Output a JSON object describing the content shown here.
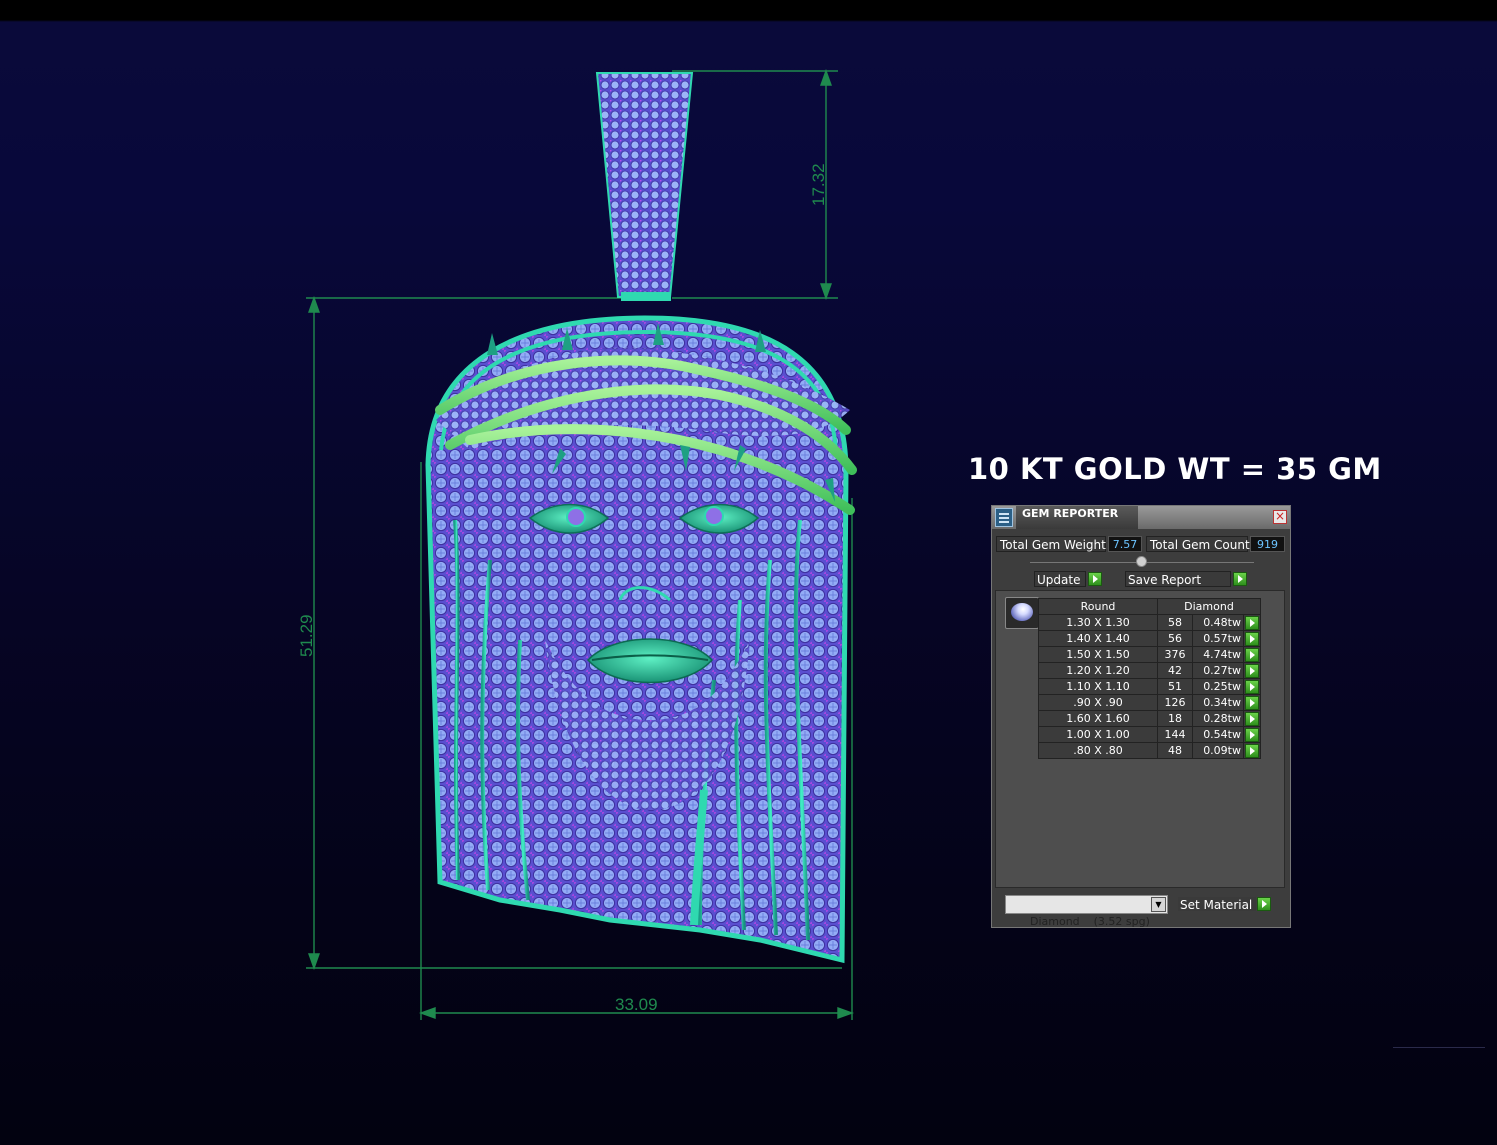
{
  "headline": "10 KT GOLD WT = 35 GM",
  "dimensions": {
    "bail_height": "17.32",
    "pendant_height": "51.29",
    "pendant_width": "33.09"
  },
  "gem_reporter": {
    "title": "GEM REPORTER",
    "total_gem_weight_label": "Total Gem Weight",
    "total_gem_weight_value": "7.57",
    "total_gem_count_label": "Total Gem Count",
    "total_gem_count_value": "919",
    "update_label": "Update",
    "save_report_label": "Save Report",
    "table": {
      "headers": [
        "Round",
        "Diamond"
      ],
      "rows": [
        {
          "size": "1.30 X 1.30",
          "count": "58",
          "ctw": "0.48tw"
        },
        {
          "size": "1.40 X 1.40",
          "count": "56",
          "ctw": "0.57tw"
        },
        {
          "size": "1.50 X 1.50",
          "count": "376",
          "ctw": "4.74tw"
        },
        {
          "size": "1.20 X 1.20",
          "count": "42",
          "ctw": "0.27tw"
        },
        {
          "size": "1.10 X 1.10",
          "count": "51",
          "ctw": "0.25tw"
        },
        {
          "size": ".90 X .90",
          "count": "126",
          "ctw": "0.34tw"
        },
        {
          "size": "1.60 X 1.60",
          "count": "18",
          "ctw": "0.28tw"
        },
        {
          "size": "1.00 X 1.00",
          "count": "144",
          "ctw": "0.54tw"
        },
        {
          "size": ".80 X .80",
          "count": "48",
          "ctw": "0.09tw"
        }
      ]
    },
    "material_select": "Diamond    (3.52 spg)",
    "set_material_label": "Set Material"
  },
  "colors": {
    "background": "#08083a",
    "dimension_line": "#1f8a4e",
    "gem_blue": "#8ea8f5",
    "gem_purple": "#9b3fd6",
    "metal_teal": "#2fd9b0",
    "metal_green": "#7ee08a",
    "window_bg": "#3d3d3d",
    "value_text": "#6cc4ff"
  }
}
